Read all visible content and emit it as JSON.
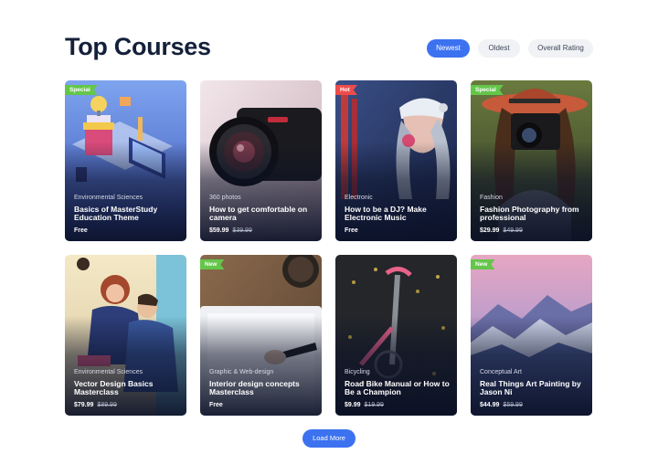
{
  "page": {
    "title": "Top Courses"
  },
  "filters": [
    {
      "label": "Newest",
      "active": true
    },
    {
      "label": "Oldest",
      "active": false
    },
    {
      "label": "Overall Rating",
      "active": false
    }
  ],
  "courses": [
    {
      "badge": "Special",
      "badge_color": "#64c64a",
      "category": "Environmental Sciences",
      "title": "Basics of MasterStudy Education Theme",
      "price": "Free",
      "old_price": ""
    },
    {
      "badge": "",
      "badge_color": "",
      "category": "360 photos",
      "title": "How to get comfortable on camera",
      "price": "$59.99",
      "old_price": "$39.99"
    },
    {
      "badge": "Hot",
      "badge_color": "#ee4b4b",
      "category": "Electronic",
      "title": "How to be a DJ? Make Electronic Music",
      "price": "Free",
      "old_price": ""
    },
    {
      "badge": "Special",
      "badge_color": "#64c64a",
      "category": "Fashion",
      "title": "Fashion Photography from professional",
      "price": "$29.99",
      "old_price": "$49.99"
    },
    {
      "badge": "",
      "badge_color": "",
      "category": "Environmental Sciences",
      "title": "Vector Design Basics Masterclass",
      "price": "$79.99",
      "old_price": "$89.99"
    },
    {
      "badge": "New",
      "badge_color": "#64c64a",
      "category": "Graphic & Web-design",
      "title": "Interior design concepts Masterclass",
      "price": "Free",
      "old_price": ""
    },
    {
      "badge": "",
      "badge_color": "",
      "category": "Bicycling",
      "title": "Road Bike Manual or How to Be a Champion",
      "price": "$9.99",
      "old_price": "$19.99"
    },
    {
      "badge": "New",
      "badge_color": "#64c64a",
      "category": "Conceptual Art",
      "title": "Real Things Art Painting by Jason Ni",
      "price": "$44.99",
      "old_price": "$59.99"
    }
  ],
  "load_more": {
    "label": "Load More"
  },
  "colors": {
    "accent": "#3c72f0",
    "badge_green": "#64c64a",
    "badge_red": "#ee4b4b"
  }
}
